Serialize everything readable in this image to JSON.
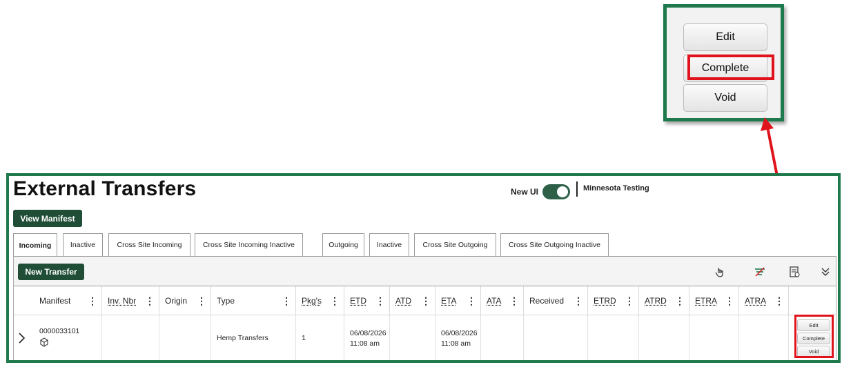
{
  "callout": {
    "buttons": [
      "Edit",
      "Complete",
      "Void"
    ]
  },
  "header": {
    "title": "External Transfers",
    "new_ui_label": "New UI",
    "new_ui_enabled": true,
    "facility": "Minnesota Testing"
  },
  "actions": {
    "view_manifest": "View Manifest",
    "new_transfer": "New Transfer"
  },
  "tabs": [
    {
      "label": "Incoming",
      "active": true
    },
    {
      "label": "Inactive"
    },
    {
      "label": "Cross Site Incoming"
    },
    {
      "label": "Cross Site Incoming Inactive"
    },
    {
      "label": "Outgoing"
    },
    {
      "label": "Inactive"
    },
    {
      "label": "Cross Site Outgoing"
    },
    {
      "label": "Cross Site Outgoing Inactive"
    }
  ],
  "toolbar_icons": [
    "pointer-icon",
    "filter-clear-icon",
    "export-icon",
    "chevron-double-down-icon"
  ],
  "grid": {
    "columns": [
      "Manifest",
      "Inv. Nbr",
      "Origin",
      "Type",
      "Pkg's",
      "ETD",
      "ATD",
      "ETA",
      "ATA",
      "Received",
      "ETRD",
      "ATRD",
      "ETRA",
      "ATRA"
    ],
    "rows": [
      {
        "manifest": "0000033101",
        "inv_nbr": "",
        "origin": "",
        "type": "Hemp Transfers",
        "pkgs": "1",
        "etd_date": "06/08/2026",
        "etd_time": "11:08 am",
        "atd": "",
        "eta_date": "06/08/2026",
        "eta_time": "11:08 am",
        "ata": "",
        "received": "",
        "etrd": "",
        "atrd": "",
        "etra": "",
        "atra": ""
      }
    ],
    "row_actions": [
      "Edit",
      "Complete",
      "Void"
    ]
  },
  "colors": {
    "frame": "#1e7a4c",
    "primary_button": "#1f4d36",
    "highlight": "#e0121b"
  }
}
